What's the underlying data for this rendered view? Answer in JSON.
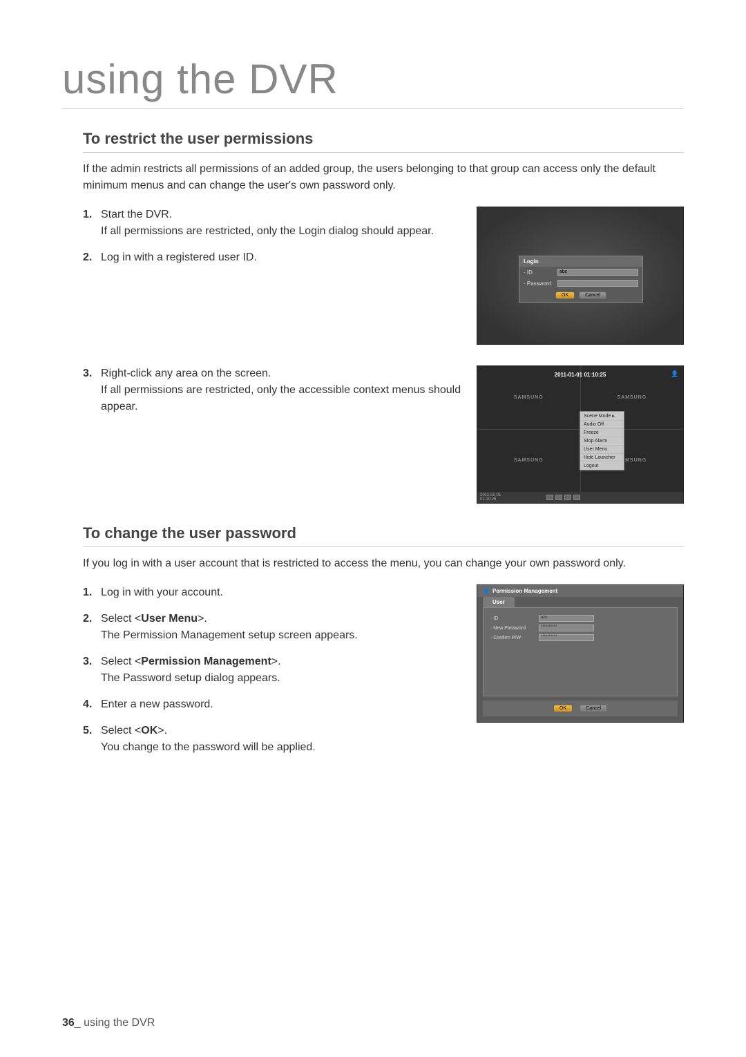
{
  "main_title": "using the DVR",
  "section1": {
    "title": "To restrict the user permissions",
    "intro": "If the admin restricts all permissions of an added group, the users belonging to that group can access only the default minimum menus and can change the user's own password only.",
    "step1_a": "Start the DVR.",
    "step1_b": "If all permissions are restricted, only the Login dialog should appear.",
    "step2": "Log in with a registered user ID.",
    "step3_a": "Right-click any area on the screen.",
    "step3_b": "If all permissions are restricted, only the accessible context menus should appear."
  },
  "login_dialog": {
    "title": "Login",
    "id_label": "· ID",
    "id_value": "abc",
    "pw_label": "· Password",
    "ok": "OK",
    "cancel": "Cancel"
  },
  "context_screen": {
    "timestamp": "2011-01-01 01:10:25",
    "logo": "SAMSUNG",
    "menu": [
      "Scene Mode   ▸",
      "Audio Off",
      "Freeze",
      "Stop Alarm",
      "User Menu",
      "Hide Launcher",
      "Logout"
    ],
    "bottom_date": "2011-01-01",
    "bottom_time": "01:10:25"
  },
  "section2": {
    "title": "To change the user password",
    "intro": "If you log in with a user account that is restricted to access the menu, you can change your own password only.",
    "step1": "Log in with your account.",
    "step2_a": "Select <",
    "step2_b": "User Menu",
    "step2_c": ">.",
    "step2_d": "The Permission Management setup screen appears.",
    "step3_a": "Select <",
    "step3_b": "Permission Management",
    "step3_c": ">.",
    "step3_d": "The Password setup dialog appears.",
    "step4": "Enter a new password.",
    "step5_a": "Select <",
    "step5_b": "OK",
    "step5_c": ">.",
    "step5_d": "You change to the password will be applied."
  },
  "perm_dialog": {
    "title": "Permission Management",
    "tab": "User",
    "id_label": "· ID",
    "id_value": "abc",
    "newpw_label": "· New Password",
    "newpw_value": "**********",
    "confirm_label": "· Confirm P/W",
    "confirm_value": "**********",
    "ok": "OK",
    "cancel": "Cancel"
  },
  "footer": {
    "page": "36",
    "sep": "_",
    "section": " using the DVR"
  }
}
